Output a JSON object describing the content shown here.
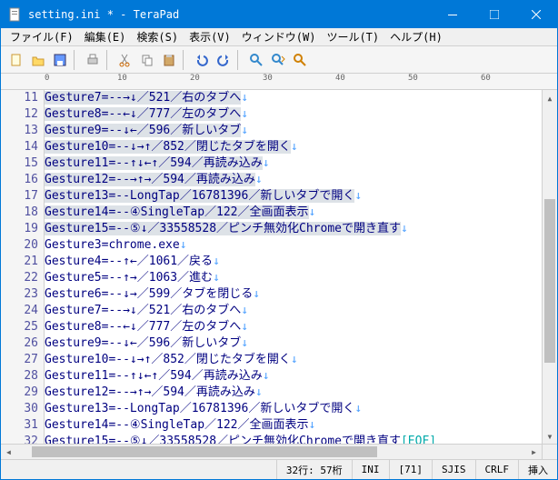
{
  "title": "setting.ini * - TeraPad",
  "menu": [
    "ファイル(F)",
    "編集(E)",
    "検索(S)",
    "表示(V)",
    "ウィンドウ(W)",
    "ツール(T)",
    "ヘルプ(H)"
  ],
  "ruler_marks": [
    "0",
    "10",
    "20",
    "30",
    "40",
    "50",
    "60"
  ],
  "lines": [
    {
      "n": 11,
      "dim": true,
      "text": "Gesture7=--→↓／521／右のタブへ",
      "eol": "↓"
    },
    {
      "n": 12,
      "dim": true,
      "text": "Gesture8=--←↓／777／左のタブへ",
      "eol": "↓"
    },
    {
      "n": 13,
      "dim": true,
      "text": "Gesture9=--↓←／596／新しいタブ",
      "eol": "↓"
    },
    {
      "n": 14,
      "dim": true,
      "text": "Gesture10=--↓→↑／852／閉じたタブを開く",
      "eol": "↓"
    },
    {
      "n": 15,
      "dim": true,
      "text": "Gesture11=--↑↓←↑／594／再読み込み",
      "eol": "↓"
    },
    {
      "n": 16,
      "dim": true,
      "text": "Gesture12=--→↑→／594／再読み込み",
      "eol": "↓"
    },
    {
      "n": 17,
      "dim": true,
      "text": "Gesture13=--LongTap／16781396／新しいタブで開く",
      "eol": "↓"
    },
    {
      "n": 18,
      "dim": true,
      "text": "Gesture14=--④SingleTap／122／全画面表示",
      "eol": "↓"
    },
    {
      "n": 19,
      "dim": true,
      "text": "Gesture15=--⑤↓／33558528／ピンチ無効化Chromeで開き直す",
      "eol": "↓"
    },
    {
      "n": 20,
      "dim": false,
      "text": "Gesture3=chrome.exe",
      "eol": "↓"
    },
    {
      "n": 21,
      "dim": false,
      "text": "Gesture4=--↑←／1061／戻る",
      "eol": "↓"
    },
    {
      "n": 22,
      "dim": false,
      "text": "Gesture5=--↑→／1063／進む",
      "eol": "↓"
    },
    {
      "n": 23,
      "dim": false,
      "text": "Gesture6=--↓→／599／タブを閉じる",
      "eol": "↓"
    },
    {
      "n": 24,
      "dim": false,
      "text": "Gesture7=--→↓／521／右のタブへ",
      "eol": "↓"
    },
    {
      "n": 25,
      "dim": false,
      "text": "Gesture8=--←↓／777／左のタブへ",
      "eol": "↓"
    },
    {
      "n": 26,
      "dim": false,
      "text": "Gesture9=--↓←／596／新しいタブ",
      "eol": "↓"
    },
    {
      "n": 27,
      "dim": false,
      "text": "Gesture10=--↓→↑／852／閉じたタブを開く",
      "eol": "↓"
    },
    {
      "n": 28,
      "dim": false,
      "text": "Gesture11=--↑↓←↑／594／再読み込み",
      "eol": "↓"
    },
    {
      "n": 29,
      "dim": false,
      "text": "Gesture12=--→↑→／594／再読み込み",
      "eol": "↓"
    },
    {
      "n": 30,
      "dim": false,
      "text": "Gesture13=--LongTap／16781396／新しいタブで開く",
      "eol": "↓"
    },
    {
      "n": 31,
      "dim": false,
      "text": "Gesture14=--④SingleTap／122／全画面表示",
      "eol": "↓"
    },
    {
      "n": 32,
      "dim": false,
      "text": "Gesture15=--⑤↓／33558528／ピンチ無効化Chromeで開き直す",
      "eof": "[EOF]"
    }
  ],
  "status": {
    "pos": "32行: 57桁",
    "type": "INI",
    "code": "[71]",
    "enc": "SJIS",
    "eol": "CRLF",
    "mode": "挿入"
  },
  "toolbar_icons": [
    "new",
    "open",
    "save",
    "|",
    "print",
    "|",
    "cut",
    "copy",
    "paste",
    "|",
    "undo",
    "redo",
    "|",
    "find",
    "find-next",
    "replace"
  ]
}
